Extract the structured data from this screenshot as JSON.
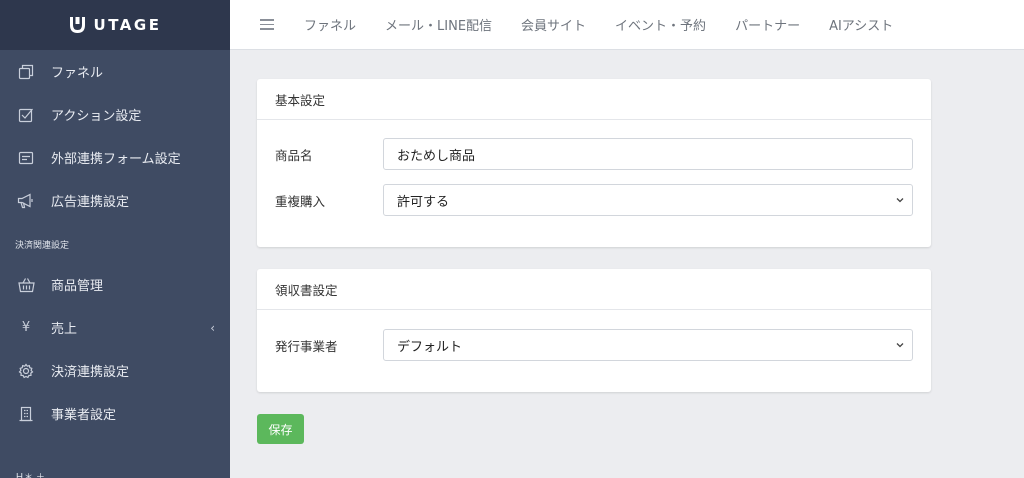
{
  "brand": {
    "name": "UTAGE"
  },
  "sidebar": {
    "items": [
      {
        "label": "ファネル",
        "icon": "copy-icon"
      },
      {
        "label": "アクション設定",
        "icon": "checkbox-icon"
      },
      {
        "label": "外部連携フォーム設定",
        "icon": "form-icon"
      },
      {
        "label": "広告連携設定",
        "icon": "megaphone-icon"
      }
    ],
    "section_payment": "決済関連設定",
    "payment_items": [
      {
        "label": "商品管理",
        "icon": "basket-icon"
      },
      {
        "label": "売上",
        "icon": "yen-icon"
      },
      {
        "label": "決済連携設定",
        "icon": "gear-icon"
      },
      {
        "label": "事業者設定",
        "icon": "building-icon"
      }
    ],
    "yen_glyph": "¥",
    "chevron_glyph": "‹",
    "cut_label": "Ｈ＊ ＋"
  },
  "topnav": {
    "items": [
      "ファネル",
      "メール・LINE配信",
      "会員サイト",
      "イベント・予約",
      "パートナー",
      "AIアシスト"
    ]
  },
  "basic_settings": {
    "title": "基本設定",
    "product_name_label": "商品名",
    "product_name_value": "おためし商品",
    "duplicate_label": "重複購入",
    "duplicate_value": "許可する"
  },
  "receipt_settings": {
    "title": "領収書設定",
    "issuer_label": "発行事業者",
    "issuer_value": "デフォルト"
  },
  "save_label": "保存",
  "colors": {
    "sidebar_bg": "#3f4b63",
    "brand_bg": "#2e374d",
    "save_button": "#5cb85c",
    "page_bg": "#ecedf0"
  }
}
